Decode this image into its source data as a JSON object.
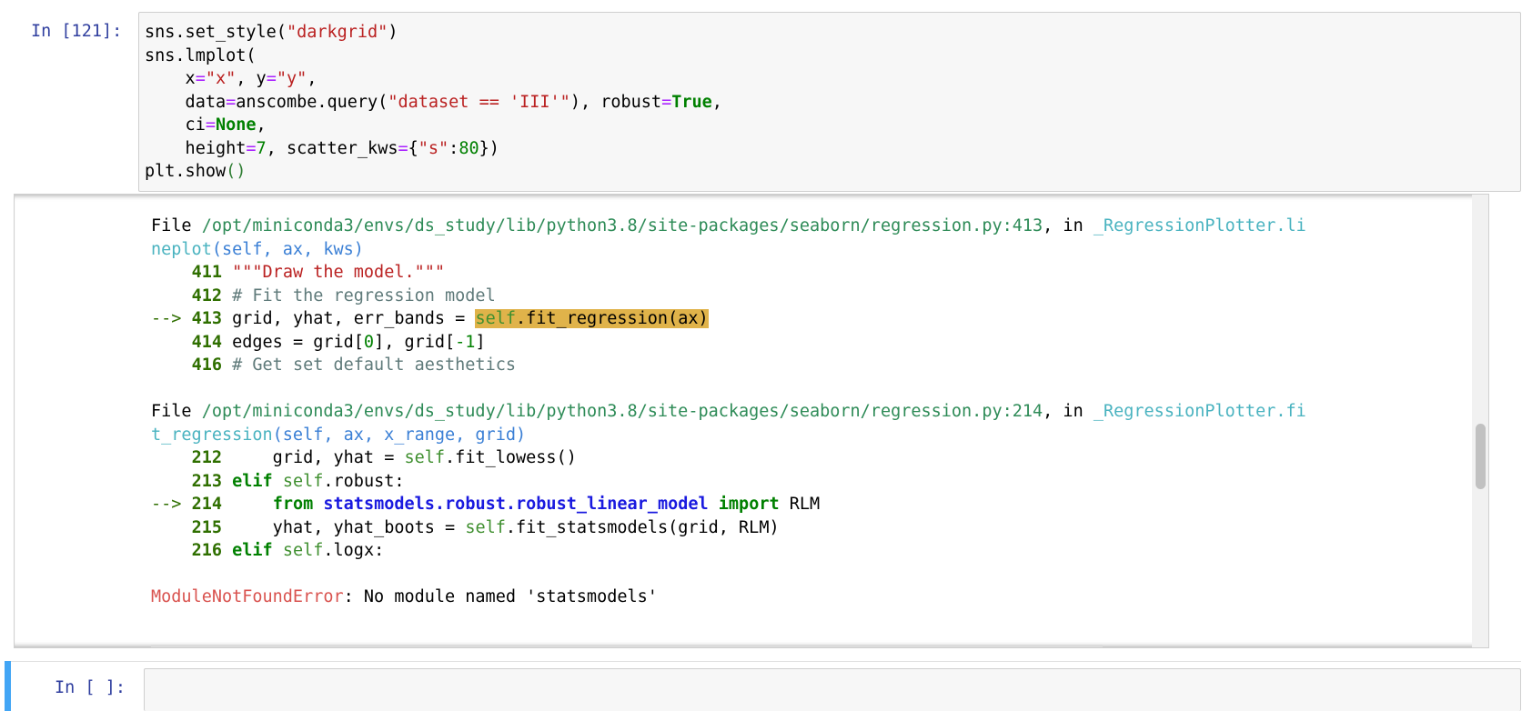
{
  "cell121": {
    "prompt": "In [121]:",
    "code": [
      "sns.set_style(\"darkgrid\")",
      "sns.lmplot(",
      "    x=\"x\", y=\"y\",",
      "    data=anscombe.query(\"dataset == 'III'\"), robust=True,",
      "    ci=None,",
      "    height=7, scatter_kws={\"s\":80})",
      "plt.show()"
    ]
  },
  "traceback": {
    "frame1": {
      "file_label": "File ",
      "path": "/opt/miniconda3/envs/ds_study/lib/python3.8/site-packages/seaborn/regression.py:413",
      "sep": ", in ",
      "func_line1": "_RegressionPlotter.li",
      "func_line2_name": "neplot",
      "func_line2_args": "(self, ax, kws)",
      "lines": {
        "l411": "411",
        "l411_text": "\"\"\"Draw the model.\"\"\"",
        "l412": "412",
        "l412_text": "# Fit the regression model",
        "arrow": "--> ",
        "l413": "413",
        "l413_pre": "grid, yhat, err_bands = ",
        "l413_self": "self",
        "l413_call": ".fit_regression(ax)",
        "l414": "414",
        "l414_text": "edges = grid[0], grid[-1]",
        "l416": "416",
        "l416_text": "# Get set default aesthetics"
      }
    },
    "frame2": {
      "file_label": "File ",
      "path": "/opt/miniconda3/envs/ds_study/lib/python3.8/site-packages/seaborn/regression.py:214",
      "sep": ", in ",
      "func_line1": "_RegressionPlotter.fi",
      "func_line2_name": "t_regression",
      "func_line2_args": "(self, ax, x_range, grid)",
      "lines": {
        "l212": "212",
        "l212_pre": "    grid, yhat = ",
        "l212_self": "self",
        "l212_post": ".fit_lowess()",
        "l213": "213",
        "l213_kw": "elif",
        "l213_self": "self",
        "l213_post": ".robust:",
        "arrow": "--> ",
        "l214": "214",
        "l214_from": "from",
        "l214_mod": "statsmodels.robust.robust_linear_model",
        "l214_import": "import",
        "l214_name": " RLM",
        "l215": "215",
        "l215_pre": "    yhat, yhat_boots = ",
        "l215_self": "self",
        "l215_post": ".fit_statsmodels(grid, RLM)",
        "l216": "216",
        "l216_kw": "elif",
        "l216_self": "self",
        "l216_post": ".logx:"
      }
    },
    "error_type": "ModuleNotFoundError",
    "error_msg": ": No module named 'statsmodels'"
  },
  "empty_cell": {
    "prompt": "In [ ]:"
  },
  "colors": {
    "prompt": "#303f9f",
    "string": "#ba2121",
    "keyword": "#008000",
    "error": "#d9534f",
    "highlight": "#e0b34a",
    "selected": "#42a5f5"
  }
}
